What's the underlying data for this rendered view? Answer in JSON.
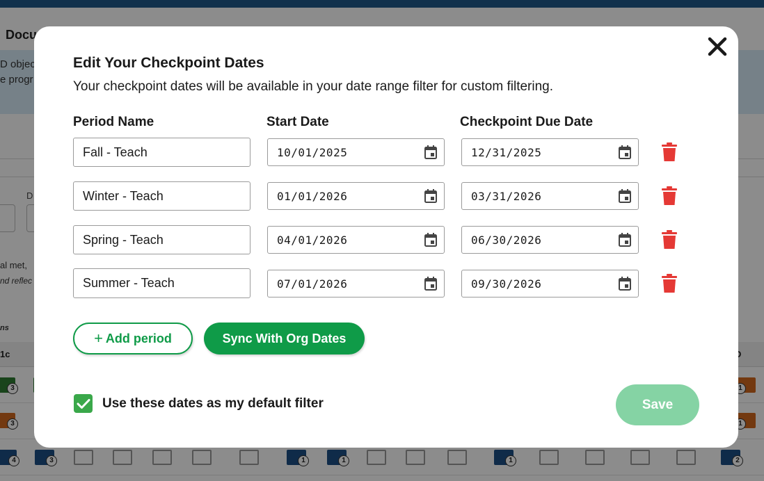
{
  "background": {
    "title": "Docu",
    "banner_line1": "D objec",
    "banner_line2": "e progr",
    "filter_label": "D",
    "text_line1": "al met,",
    "text_line2": "nd reflec",
    "text_line3": "ns",
    "grid_head_left": "1c",
    "grid_head_right": "D"
  },
  "modal": {
    "title": "Edit Your Checkpoint Dates",
    "subtitle": "Your checkpoint dates will be available in your date range filter for custom filtering.",
    "columns": {
      "period_name": "Period Name",
      "start_date": "Start Date",
      "due_date": "Checkpoint Due Date"
    },
    "periods": [
      {
        "name": "Fall - Teach",
        "start": "10/01/2025",
        "due": "12/31/2025"
      },
      {
        "name": "Winter - Teach",
        "start": "01/01/2026",
        "due": "03/31/2026"
      },
      {
        "name": "Spring - Teach",
        "start": "04/01/2026",
        "due": "06/30/2026"
      },
      {
        "name": "Summer - Teach",
        "start": "07/01/2026",
        "due": "09/30/2026"
      }
    ],
    "add_period_label": "Add period",
    "add_period_icon": "+",
    "sync_label": "Sync With Org Dates",
    "default_filter_label": "Use these dates as my default filter",
    "default_filter_checked": true,
    "save_label": "Save"
  },
  "colors": {
    "primary_green": "#0f9b48",
    "checkbox_green": "#3aa84a",
    "save_disabled": "#85d3a4",
    "trash_red": "#e53935"
  }
}
